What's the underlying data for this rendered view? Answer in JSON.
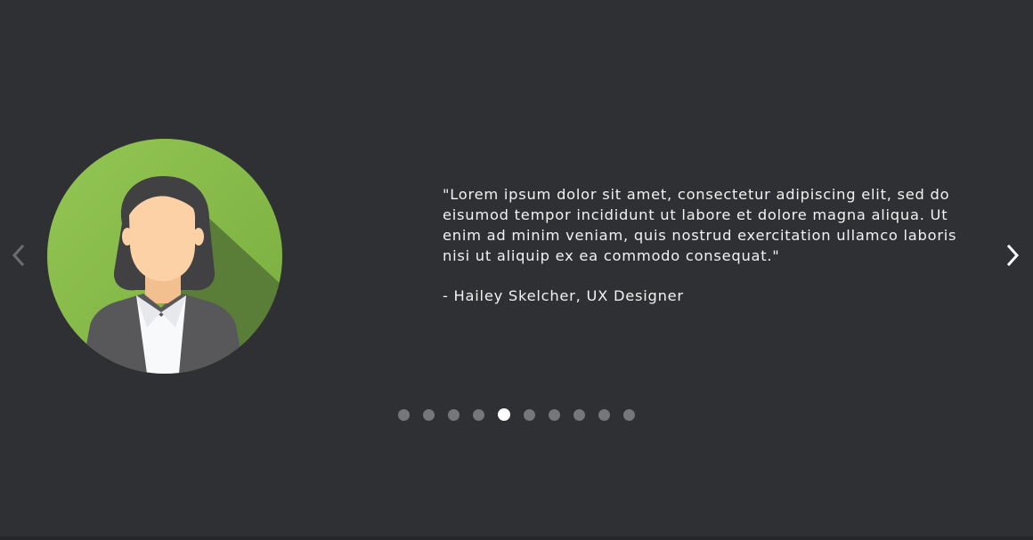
{
  "testimonial": {
    "quote": "\"Lorem ipsum dolor sit amet, consectetur adipiscing elit, sed do eisumod tempor incididunt ut labore et dolore magna aliqua. Ut enim ad minim veniam, quis nostrud exercitation ullamco laboris nisi ut aliquip ex ea commodo consequat.\"",
    "author": "- Hailey Skelcher, UX Designer"
  },
  "avatar": {
    "icon": "businesswoman-avatar-icon",
    "background_color": "#8bc34a"
  },
  "navigation": {
    "prev_icon": "chevron-left-icon",
    "next_icon": "chevron-right-icon"
  },
  "pagination": {
    "total": 10,
    "active_index": 4,
    "active_color": "#ffffff",
    "inactive_color": "#75777a"
  },
  "colors": {
    "background": "#2e3033",
    "text": "#f2f2f2"
  }
}
